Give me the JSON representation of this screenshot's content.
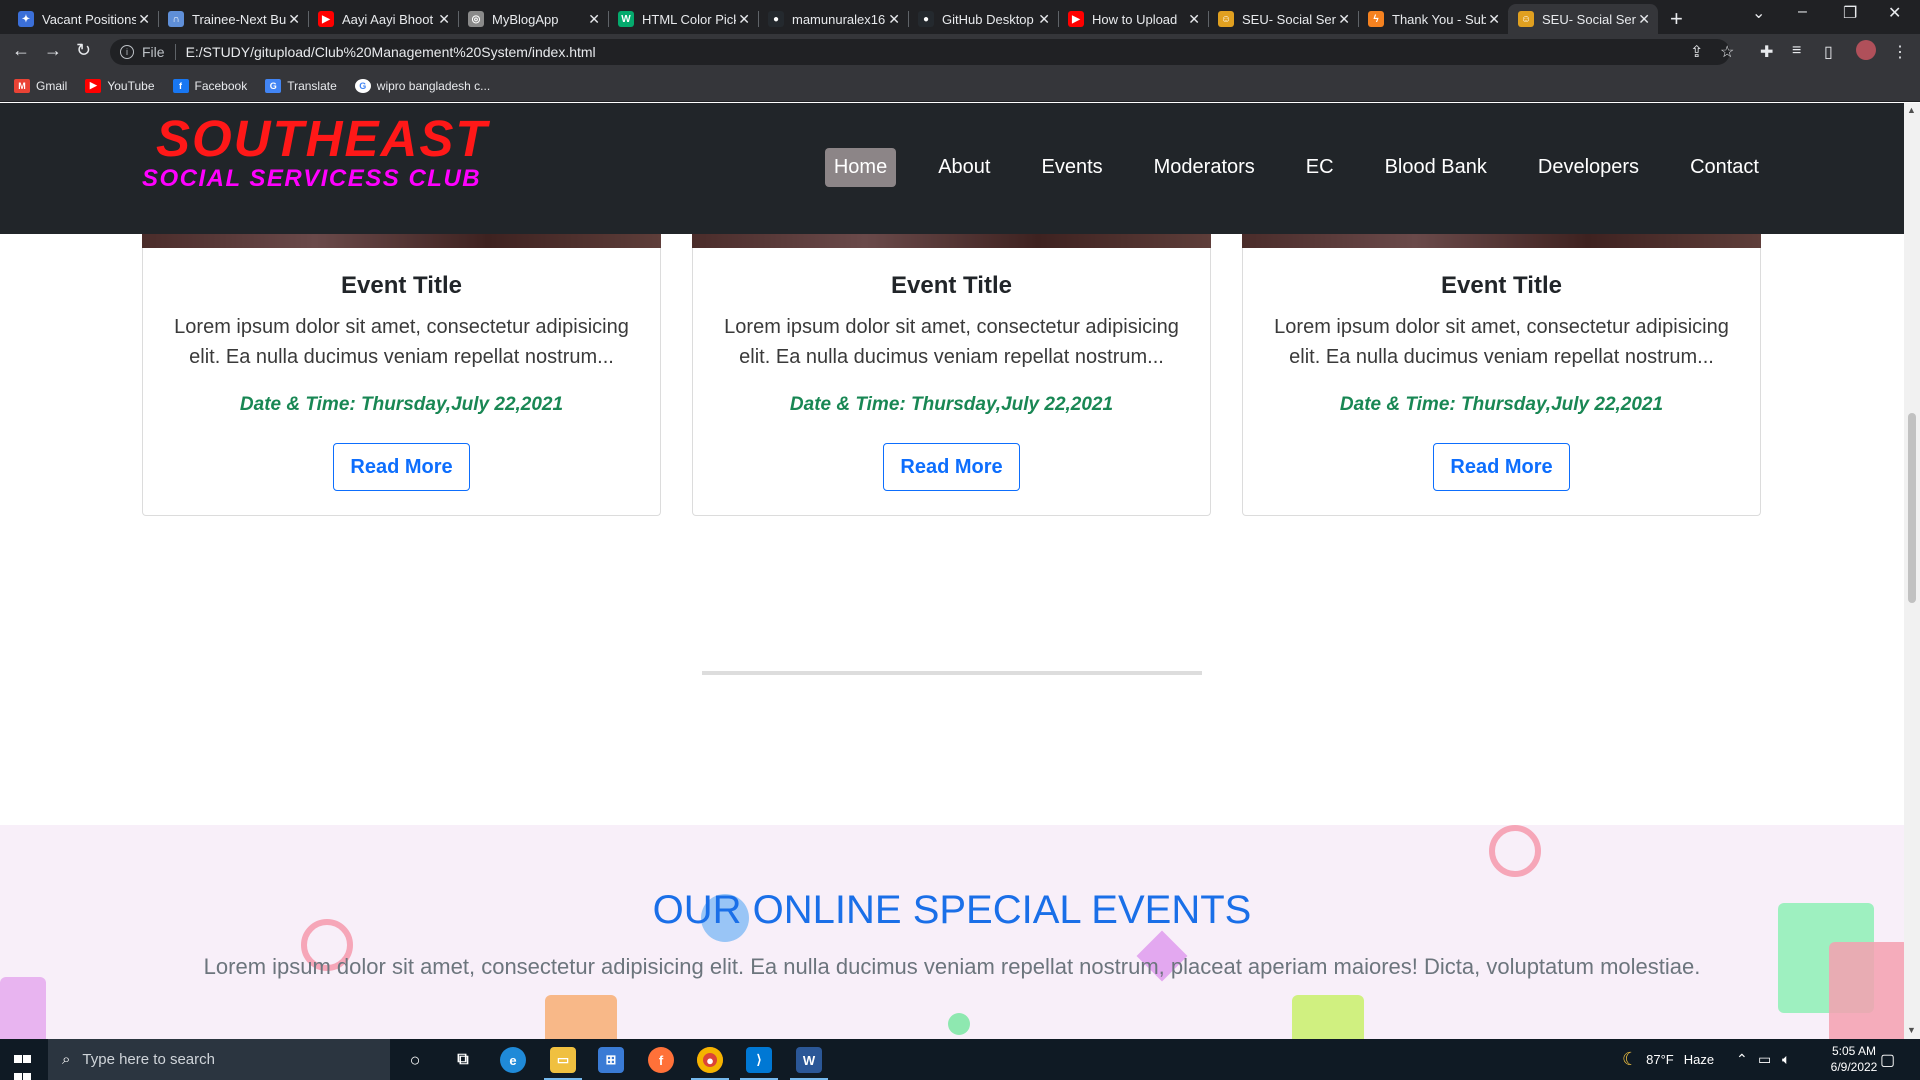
{
  "browser": {
    "tabs": [
      {
        "title": "Vacant Positions",
        "icon": "wipro-icon",
        "color": "#3b6fd8"
      },
      {
        "title": "Trainee-Next Bu",
        "icon": "headset-icon",
        "color": "#5f8fd8"
      },
      {
        "title": "Aayi Aayi Bhoot",
        "icon": "youtube-icon",
        "color": "#ff0000"
      },
      {
        "title": "MyBlogApp",
        "icon": "globe-icon",
        "color": "#8a8a8a"
      },
      {
        "title": "HTML Color Pick",
        "icon": "w3schools-icon",
        "color": "#04aa6d"
      },
      {
        "title": "mamunuralex16",
        "icon": "github-icon",
        "color": "#24292e"
      },
      {
        "title": "GitHub Desktop",
        "icon": "github-icon",
        "color": "#24292e"
      },
      {
        "title": "How to Upload",
        "icon": "youtube-icon",
        "color": "#ff0000"
      },
      {
        "title": "SEU- Social Ser",
        "icon": "seu-icon",
        "color": "#e0a020"
      },
      {
        "title": "Thank You - Sub",
        "icon": "bolt-icon",
        "color": "#f58220"
      },
      {
        "title": "SEU- Social Serv",
        "icon": "seu-icon",
        "color": "#e0a020"
      }
    ],
    "active_tab_index": 10,
    "new_tab": "+",
    "address": {
      "scheme_label": "File",
      "url": "E:/STUDY/gitupload/Club%20Management%20System/index.html"
    },
    "bookmarks": [
      {
        "label": "Gmail",
        "icon": "gmail-icon",
        "color": "#ea4335"
      },
      {
        "label": "YouTube",
        "icon": "youtube-icon",
        "color": "#ff0000"
      },
      {
        "label": "Facebook",
        "icon": "facebook-icon",
        "color": "#1877f2"
      },
      {
        "label": "Translate",
        "icon": "translate-icon",
        "color": "#4285f4"
      },
      {
        "label": "wipro bangladesh c...",
        "icon": "google-icon",
        "color": "#ffffff"
      }
    ]
  },
  "site": {
    "brand_line1": "SOUTHEAST",
    "brand_line2": "SOCIAL SERVICESS CLUB",
    "nav": [
      "Home",
      "About",
      "Events",
      "Moderators",
      "EC",
      "Blood Bank",
      "Developers",
      "Contact"
    ],
    "active_nav": "Home",
    "colors": {
      "brand_red": "#ff1818",
      "brand_magenta": "#ff00ff",
      "date_green": "#198754",
      "button_blue": "#0d6efd"
    },
    "events": [
      {
        "title": "Event Title",
        "text": "Lorem ipsum dolor sit amet, consectetur adipisicing elit. Ea nulla ducimus veniam repellat nostrum...",
        "date": "Date & Time: Thursday,July 22,2021",
        "button": "Read More"
      },
      {
        "title": "Event Title",
        "text": "Lorem ipsum dolor sit amet, consectetur adipisicing elit. Ea nulla ducimus veniam repellat nostrum...",
        "date": "Date & Time: Thursday,July 22,2021",
        "button": "Read More"
      },
      {
        "title": "Event Title",
        "text": "Lorem ipsum dolor sit amet, consectetur adipisicing elit. Ea nulla ducimus veniam repellat nostrum...",
        "date": "Date & Time: Thursday,July 22,2021",
        "button": "Read More"
      }
    ],
    "special": {
      "heading": "OUR ONLINE SPECIAL EVENTS",
      "lead": "Lorem ipsum dolor sit amet, consectetur adipisicing elit. Ea nulla ducimus veniam repellat nostrum, placeat aperiam maiores! Dicta, voluptatum molestiae."
    }
  },
  "taskbar": {
    "search_placeholder": "Type here to search",
    "weather_temp": "87°F",
    "weather_text": "Haze",
    "time": "5:05 AM",
    "date": "6/9/2022"
  }
}
